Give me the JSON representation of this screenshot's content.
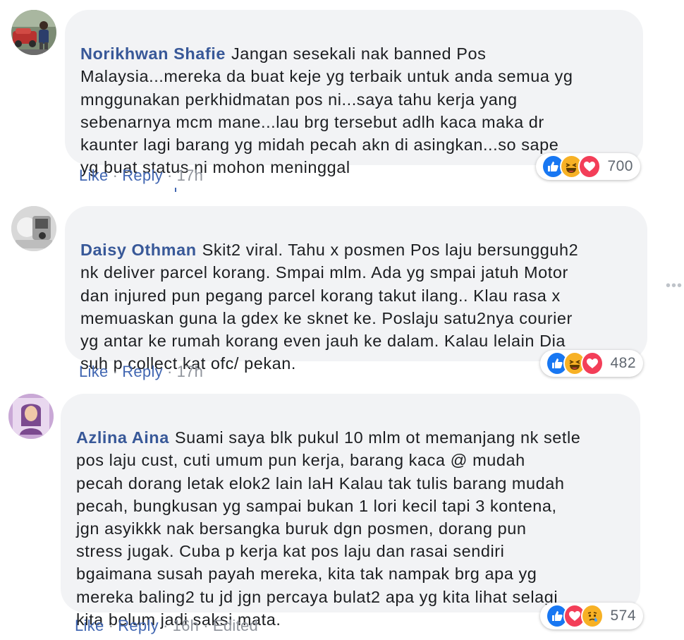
{
  "comments": [
    {
      "author": "Norikhwan Shafie",
      "text": "Jangan sesekali nak banned Pos\nMalaysia...mereka da buat keje yg terbaik untuk anda semua yg\nmnggunakan perkhidmatan pos ni...saya tahu kerja yang\nsebenarnya mcm mane...lau brg tersebut adlh kaca maka dr\nkaunter lagi barang yg midah pecah akn di asingkan...so sape\nyg buat status ni mohon meninggal",
      "like_label": "Like",
      "reply_label": "Reply",
      "time": "17h",
      "edited": "",
      "reactions": [
        "like-icon",
        "haha-icon",
        "love-icon"
      ],
      "reaction_count": "700"
    },
    {
      "author": "Daisy Othman",
      "text": "Skit2 viral. Tahu x posmen Pos laju bersungguh2\nnk deliver parcel korang. Smpai mlm. Ada yg smpai jatuh Motor\ndan injured pun pegang parcel korang takut ilang.. Klau rasa x\nmemuaskan guna la gdex ke sknet ke. Poslaju satu2nya courier\nyg antar ke rumah korang even jauh ke dalam. Kalau lelain Dia\nsuh p collect kat ofc/ pekan.",
      "like_label": "Like",
      "reply_label": "Reply",
      "time": "17h",
      "edited": "",
      "reactions": [
        "like-icon",
        "haha-icon",
        "love-icon"
      ],
      "reaction_count": "482"
    },
    {
      "author": "Azlina Aina",
      "text": "Suami saya blk pukul 10 mlm ot memanjang nk setle\npos laju cust, cuti umum pun kerja, barang kaca @ mudah\npecah dorang letak elok2 lain laH Kalau tak tulis barang mudah\npecah, bungkusan yg sampai bukan 1 lori kecil tapi 3 kontena,\njgn asyikkk nak bersangka buruk dgn posmen, dorang pun\nstress jugak. Cuba p kerja kat pos laju dan rasai sendiri\nbgaimana susah payah mereka, kita tak nampak brg apa yg\nmereka baling2 tu jd jgn percaya bulat2 apa yg kita lihat selagi\nkita belum jadi saksi mata.",
      "like_label": "Like",
      "reply_label": "Reply",
      "time": "16h",
      "edited": "Edited",
      "reactions": [
        "like-icon",
        "love-icon",
        "sad-icon"
      ],
      "reaction_count": "574"
    }
  ],
  "more_icon": "more-options-icon",
  "colors": {
    "author": "#385898",
    "action": "#4267b2",
    "bubble": "#f2f3f5",
    "meta": "#90949c",
    "like": "#1877f2",
    "love": "#f33e58",
    "haha": "#f7b125"
  }
}
